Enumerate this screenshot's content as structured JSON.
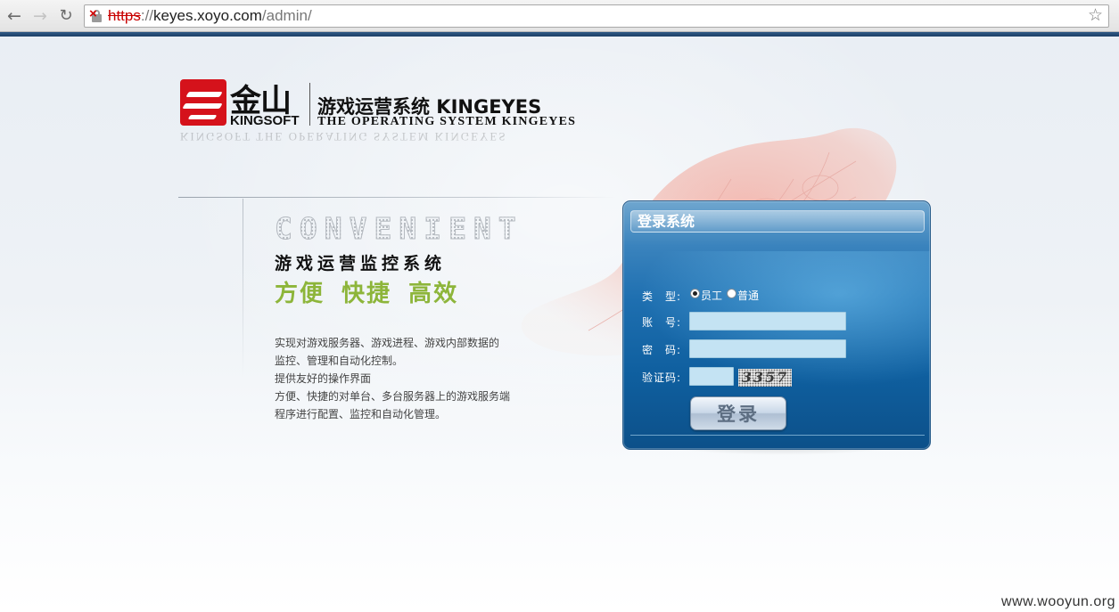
{
  "browser": {
    "url_scheme": "https",
    "url_separator": "://",
    "url_host": "keyes.xoyo.com",
    "url_path": "/admin/",
    "icons": {
      "back": "back-arrow-icon",
      "forward": "forward-arrow-icon",
      "reload": "reload-icon",
      "security": "insecure-lock-icon",
      "bookmark": "star-icon"
    }
  },
  "brand": {
    "logo_cn": "金山",
    "logo_en": "KINGSOFT",
    "title_cn": "游戏运营系统 KINGEYES",
    "title_en": "THE OPERATING SYSTEM KINGEYES",
    "reflection": "KINGSOFT      THE OPERATING SYSTEM KINGEYES",
    "logo_color": "#d5121b"
  },
  "intro": {
    "decor_word": "CONVENIENT",
    "headline": "游戏运营监控系统",
    "slogan": "方便  快捷  高效",
    "slogan_color": "#8db53a",
    "description_lines": [
      "实现对游戏服务器、游戏进程、游戏内部数据的",
      "监控、管理和自动化控制。",
      "提供友好的操作界面",
      "方便、快捷的对单台、多台服务器上的游戏服务端",
      "程序进行配置、监控和自动化管理。"
    ]
  },
  "login": {
    "title": "登录系统",
    "type_label": "类　型:",
    "type_options": [
      {
        "label": "员工",
        "checked": true
      },
      {
        "label": "普通",
        "checked": false
      }
    ],
    "account_label": "账　号:",
    "account_value": "",
    "password_label": "密　码:",
    "password_value": "",
    "captcha_label": "验证码:",
    "captcha_value": "",
    "captcha_text": "3357",
    "submit_label": "登录",
    "panel_color": "#1e6fb0"
  },
  "watermark": "www.wooyun.org"
}
